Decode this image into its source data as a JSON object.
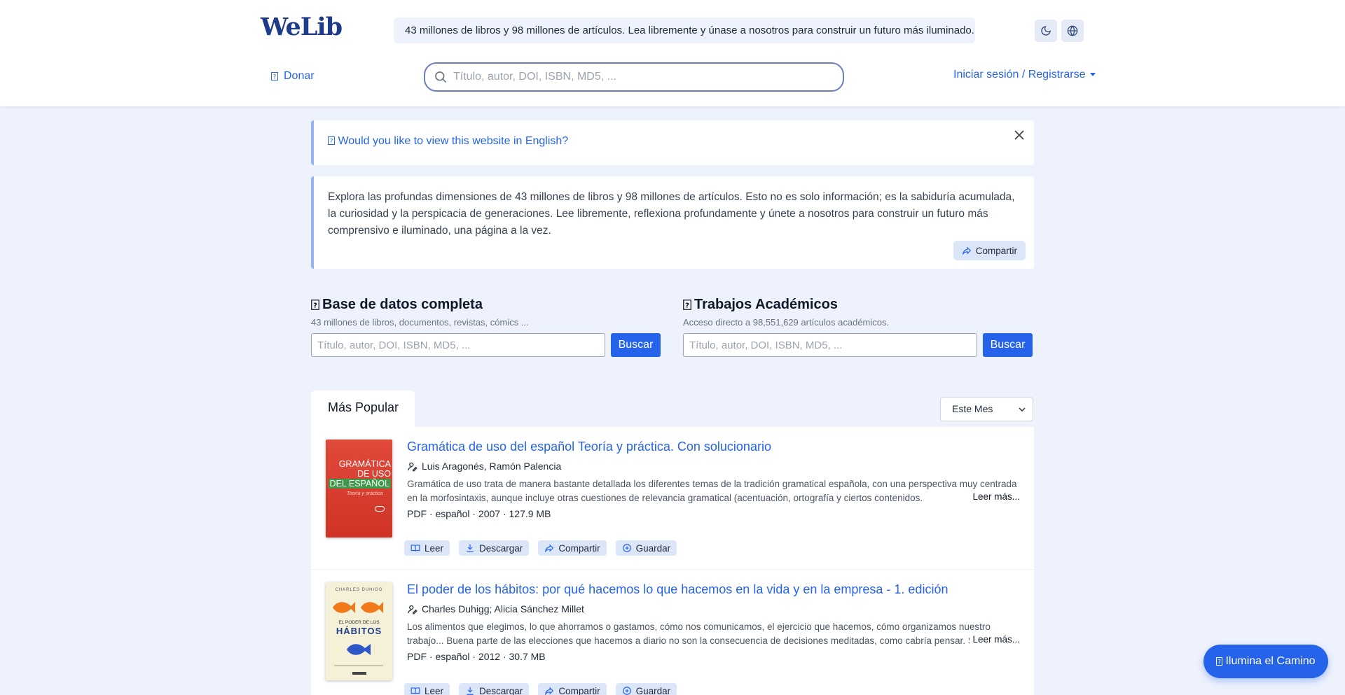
{
  "header": {
    "logo": "WeLib",
    "banner": "43 millones de libros y 98 millones de artículos. Lea libremente y únase a nosotros para construir un futuro más iluminado.",
    "theme_icon": "moon-icon",
    "language_icon": "globe-icon",
    "donate_label": "Donar",
    "search_placeholder": "Título, autor, DOI, ISBN, MD5, ...",
    "search_value": "",
    "login_label": "Iniciar sesión / Registrarse"
  },
  "language_prompt": {
    "text": "Would you like to view this website in English?"
  },
  "intro": {
    "text": "Explora las profundas dimensiones de 43 millones de libros y 98 millones de artículos. Esto no es solo información; es la sabiduría acumulada, la curiosidad y la perspicacia de generaciones. Lee libremente, reflexiona profundamente y únete a nosotros para construir un futuro más comprensivo e iluminado, una página a la vez.",
    "share_label": "Compartir"
  },
  "search_boxes": [
    {
      "title": "Base de datos completa",
      "subtitle": "43 millones de libros, documentos, revistas, cómics ...",
      "placeholder": "Título, autor, DOI, ISBN, MD5, ...",
      "button": "Buscar"
    },
    {
      "title": "Trabajos Académicos",
      "subtitle": "Acceso directo a 98,551,629 artículos académicos.",
      "placeholder": "Título, autor, DOI, ISBN, MD5, ...",
      "button": "Buscar"
    }
  ],
  "popular": {
    "tab_label": "Más Popular",
    "period": "Este Mes",
    "more_label": "Leer más...",
    "actions": {
      "read": "Leer",
      "download": "Descargar",
      "share": "Compartir",
      "save": "Guardar"
    },
    "books": [
      {
        "title": "Gramática de uso del español Teoría y práctica. Con solucionario",
        "authors": "Luis Aragonés, Ramón Palencia",
        "description": "Gramática de uso trata de manera bastante detallada los diferentes temas de la tradición gramatical española, con una perspectiva muy centrada en la morfosintaxis, aunque incluye otras cuestiones de relevancia gramatical (acentuación, ortografía y ciertos contenidos.",
        "meta": "PDF · español · 2007 · 127.9 MB",
        "cover_text_1": "GRAMÁTICA",
        "cover_text_2": "DE USO",
        "cover_text_3": "DEL ESPAÑOL",
        "cover_text_4": "Teoría y práctica"
      },
      {
        "title": "El poder de los hábitos: por qué hacemos lo que hacemos en la vida y en la empresa - 1. edición",
        "authors": "Charles Duhigg; Alicia Sánchez Millet",
        "description": "Los alimentos que elegimos, lo que ahorramos o gastamos, cómo nos comunicamos, el ejercicio que hacemos, cómo organizamos nuestro trabajo... Buena parte de las elecciones que hacemos a diario no son la consecuencia de decisiones meditadas, como cabría pensar. Son hábitos.",
        "meta": "PDF · español · 2012 · 30.7 MB",
        "cover_text_1": "CHARLES DUHIGG",
        "cover_text_2": "EL PODER DE LOS",
        "cover_text_3": "HÁBITOS"
      }
    ]
  },
  "fab_label": "Ilumina el Camino",
  "colors": {
    "brand": "#1e3a8a",
    "accent": "#2563eb",
    "page_bg": "#eef2fc",
    "pill_bg": "#dbe6f8"
  }
}
